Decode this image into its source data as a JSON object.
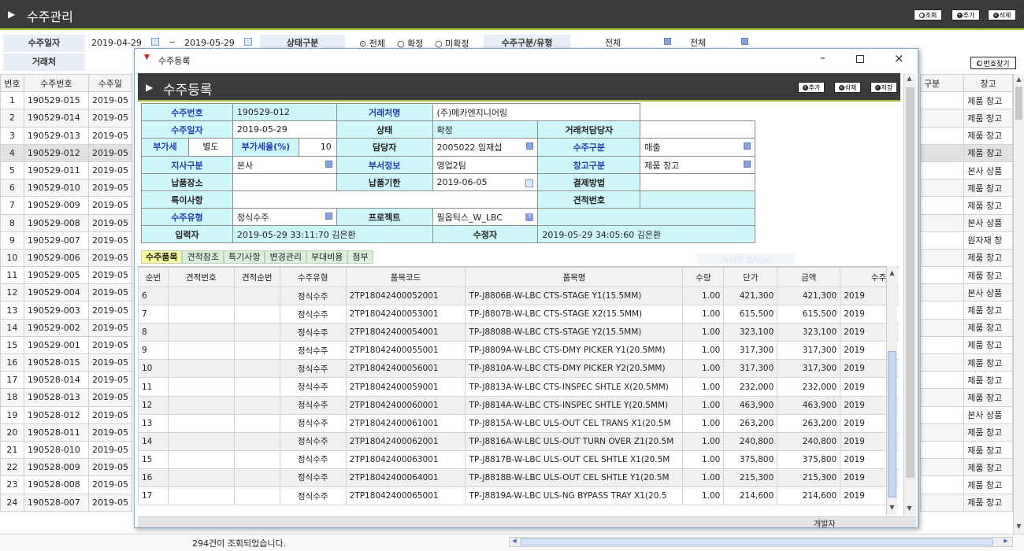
{
  "app": {
    "title": "수주관리",
    "buttons": [
      "조회",
      "추가",
      "삭제"
    ]
  },
  "filters": {
    "order_date_label": "수주일자",
    "date_from": "2019-04-29",
    "date_to": "2019-05-29",
    "tilde": "~",
    "status_label": "상태구분",
    "status_options": [
      "전체",
      "확정",
      "미확정"
    ],
    "type_label": "수주구분/유형",
    "type_value1": "전체",
    "type_value2": "전체",
    "customer_label": "거래처",
    "code_search_button": "번호찾기"
  },
  "grid": {
    "columns": [
      "번호",
      "수주번호",
      "수주일"
    ],
    "right_columns": [
      "구분",
      "창고"
    ],
    "rows": [
      [
        "1",
        "190529-015",
        "2019-05",
        "제품 창고"
      ],
      [
        "2",
        "190529-014",
        "2019-05",
        "제품 창고"
      ],
      [
        "3",
        "190529-013",
        "2019-05",
        "제품 창고"
      ],
      [
        "4",
        "190529-012",
        "2019-05",
        "제품 창고"
      ],
      [
        "5",
        "190529-011",
        "2019-05",
        "본사 상품"
      ],
      [
        "6",
        "190529-010",
        "2019-05",
        "제품 창고"
      ],
      [
        "7",
        "190529-009",
        "2019-05",
        "제품 창고"
      ],
      [
        "8",
        "190529-008",
        "2019-05",
        "본사 상품"
      ],
      [
        "9",
        "190529-007",
        "2019-05",
        "원자재 창"
      ],
      [
        "10",
        "190529-006",
        "2019-05",
        "제품 창고"
      ],
      [
        "11",
        "190529-005",
        "2019-05",
        "제품 창고"
      ],
      [
        "12",
        "190529-004",
        "2019-05",
        "본사 상품"
      ],
      [
        "13",
        "190529-003",
        "2019-05",
        "제품 창고"
      ],
      [
        "14",
        "190529-002",
        "2019-05",
        "제품 창고"
      ],
      [
        "15",
        "190529-001",
        "2019-05",
        "제품 창고"
      ],
      [
        "16",
        "190528-015",
        "2019-05",
        "제품 창고"
      ],
      [
        "17",
        "190528-014",
        "2019-05",
        "제품 창고"
      ],
      [
        "18",
        "190528-013",
        "2019-05",
        "제품 창고"
      ],
      [
        "19",
        "190528-012",
        "2019-05",
        "본사 상품"
      ],
      [
        "20",
        "190528-011",
        "2019-05",
        "제품 창고"
      ],
      [
        "21",
        "190528-010",
        "2019-05",
        "제품 창고"
      ],
      [
        "22",
        "190528-009",
        "2019-05",
        "제품 창고"
      ],
      [
        "23",
        "190528-008",
        "2019-05",
        "제품 창고"
      ],
      [
        "24",
        "190528-007",
        "2019-05",
        "제품 창고"
      ]
    ],
    "status_text": "294건이  조회되었습니다."
  },
  "dialog": {
    "window_title": "수주등록",
    "header_title": "수주등록",
    "buttons": [
      "추가",
      "삭제",
      "저장"
    ],
    "form": {
      "order_no_label": "수주번호",
      "order_no": "190529-012",
      "customer_name_label": "거래처명",
      "customer_name": "(주)메카엔지니어링",
      "order_date_label": "수주일자",
      "order_date": "2019-05-29",
      "status_label": "상태",
      "status": "확정",
      "customer_contact_label": "거래처담당자",
      "customer_contact": "",
      "vat_label": "부가세",
      "vat_value": "별도",
      "vat_rate_label": "부가세율(%)",
      "vat_rate": "10",
      "manager_label": "담당자",
      "manager": "2005022 임재섭",
      "order_type_label": "수주구분",
      "order_type": "매출",
      "branch_label": "지사구분",
      "branch": "본사",
      "dept_label": "부서정보",
      "dept": "영업2팀",
      "warehouse_label": "창고구분",
      "warehouse": "제품 창고",
      "delivery_place_label": "납품장소",
      "delivery_place": "",
      "delivery_due_label": "납품기한",
      "delivery_due": "2019-06-05",
      "payment_label": "결제방법",
      "payment": "",
      "remarks_label": "특이사항",
      "remarks": "",
      "quote_no_label": "견적번호",
      "quote_no": "",
      "order_kind_label": "수주유형",
      "order_kind": "정식수주",
      "project_label": "프로젝트",
      "project": "필옵틱스_W_LBC",
      "entered_by_label": "입력자",
      "entered_at": "2019-05-29 33:11:70",
      "entered_by": "김은환",
      "modified_by_label": "수정자",
      "modified_at": "2019-05-29 34:05:60",
      "modified_by": "김은환"
    },
    "tabs": [
      "수주품목",
      "견적참조",
      "특기사항",
      "변경관리",
      "부대비용",
      "첨부"
    ],
    "faint_label": "사리원 캡처00",
    "items": {
      "columns": [
        "순번",
        "견적번호",
        "견적순번",
        "수주유형",
        "품목코드",
        "품목명",
        "수량",
        "단가",
        "금액",
        "수주"
      ],
      "rows": [
        [
          "6",
          "",
          "",
          "정식수주",
          "2TP18042400052001",
          "TP-J8806B-W-LBC CTS-STAGE Y1(15.5MM)",
          "1.00",
          "421,300",
          "421,300",
          "2019"
        ],
        [
          "7",
          "",
          "",
          "정식수주",
          "2TP18042400053001",
          "TP-J8807B-W-LBC CTS-STAGE X2(15.5MM)",
          "1.00",
          "615,500",
          "615,500",
          "2019"
        ],
        [
          "8",
          "",
          "",
          "정식수주",
          "2TP18042400054001",
          "TP-J8808B-W-LBC CTS-STAGE Y2(15.5MM)",
          "1.00",
          "323,100",
          "323,100",
          "2019"
        ],
        [
          "9",
          "",
          "",
          "정식수주",
          "2TP18042400055001",
          "TP-J8809A-W-LBC CTS-DMY PICKER Y1(20.5MM)",
          "1.00",
          "317,300",
          "317,300",
          "2019"
        ],
        [
          "10",
          "",
          "",
          "정식수주",
          "2TP18042400056001",
          "TP-J8810A-W-LBC CTS-DMY PICKER Y2(20.5MM)",
          "1.00",
          "317,300",
          "317,300",
          "2019"
        ],
        [
          "11",
          "",
          "",
          "정식수주",
          "2TP18042400059001",
          "TP-J8813A-W-LBC CTS-INSPEC SHTLE X(20.5MM)",
          "1.00",
          "232,000",
          "232,000",
          "2019"
        ],
        [
          "12",
          "",
          "",
          "정식수주",
          "2TP18042400060001",
          "TP-J8814A-W-LBC CTS-INSPEC SHTLE Y(20.5MM)",
          "1.00",
          "463,900",
          "463,900",
          "2019"
        ],
        [
          "13",
          "",
          "",
          "정식수주",
          "2TP18042400061001",
          "TP-J8815A-W-LBC ULS-OUT CEL TRANS X1(20.5M",
          "1.00",
          "263,200",
          "263,200",
          "2019"
        ],
        [
          "14",
          "",
          "",
          "정식수주",
          "2TP18042400062001",
          "TP-J8816A-W-LBC ULS-OUT TURN OVER Z1(20.5M",
          "1.00",
          "240,800",
          "240,800",
          "2019"
        ],
        [
          "15",
          "",
          "",
          "정식수주",
          "2TP18042400063001",
          "TP-J8817B-W-LBC ULS-OUT CEL SHTLE X1(20.5M",
          "1.00",
          "375,800",
          "375,800",
          "2019"
        ],
        [
          "16",
          "",
          "",
          "정식수주",
          "2TP18042400064001",
          "TP-J8818B-W-LBC ULS-OUT CEL SHTLE Y1(20.5M",
          "1.00",
          "215,300",
          "215,300",
          "2019"
        ],
        [
          "17",
          "",
          "",
          "정식수주",
          "2TP18042400065001",
          "TP-J8819A-W-LBC ULS-NG BYPASS TRAY X1(20.5",
          "1.00",
          "214,600",
          "214,600",
          "2019"
        ]
      ]
    },
    "footer_label": "개발자"
  }
}
